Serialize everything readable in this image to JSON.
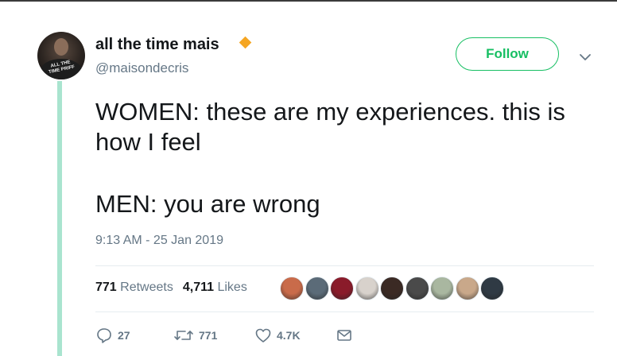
{
  "author": {
    "display_name": "all the time mais",
    "handle": "@maisondecris",
    "avatar_shirt_text": "ALL THE TIME PRIFF",
    "verified_badge_color": "#f5a623"
  },
  "follow_button": {
    "label": "Follow",
    "color": "#17bf63"
  },
  "tweet": {
    "line1": "WOMEN: these are my experiences. this is how I feel",
    "line2": "MEN: you are wrong",
    "timestamp": "9:13 AM - 25 Jan 2019"
  },
  "stats": {
    "retweets_count": "771",
    "retweets_label": "Retweets",
    "likes_count": "4,711",
    "likes_label": "Likes"
  },
  "liker_avatars": [
    {
      "color": "#c96b4a",
      "icon": "user-avatar"
    },
    {
      "color": "#5b6b78",
      "icon": "user-avatar"
    },
    {
      "color": "#8a1b2a",
      "icon": "user-avatar"
    },
    {
      "color": "#d8d2cc",
      "icon": "user-avatar"
    },
    {
      "color": "#3b2a24",
      "icon": "user-avatar"
    },
    {
      "color": "#4a4a4a",
      "icon": "user-avatar"
    },
    {
      "color": "#a9b7a0",
      "icon": "user-avatar"
    },
    {
      "color": "#c9a88a",
      "icon": "user-avatar"
    },
    {
      "color": "#2f3a44",
      "icon": "user-avatar"
    }
  ],
  "actions": {
    "reply_count": "27",
    "retweet_count": "771",
    "like_count": "4.7K"
  },
  "colors": {
    "thread_line": "#a9e4cf",
    "secondary_text": "#657786"
  }
}
